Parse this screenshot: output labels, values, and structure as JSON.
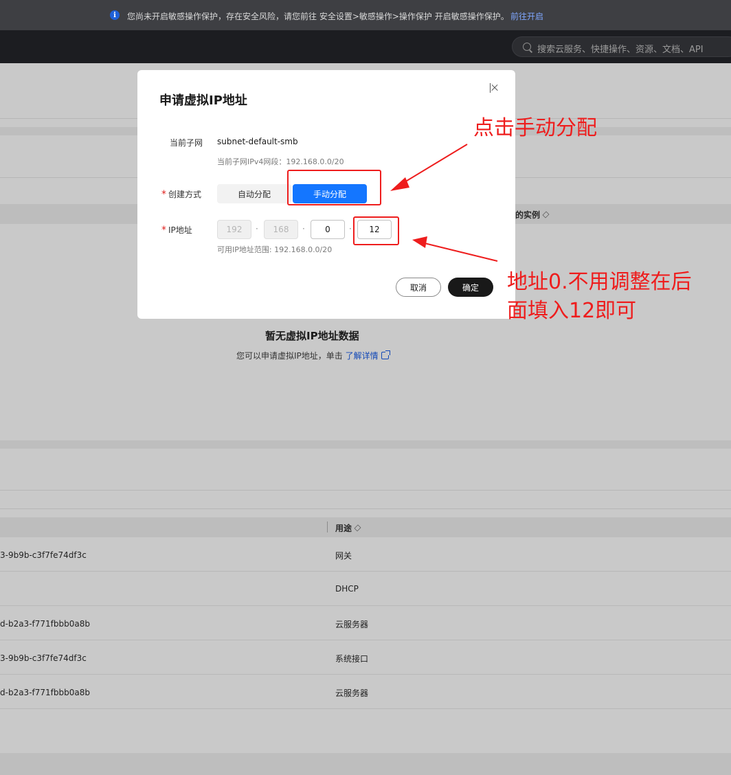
{
  "banner": {
    "info_icon": "i",
    "message": "您尚未开启敏感操作保护，存在安全风险，请您前往 安全设置>敏感操作>操作保护 开启敏感操作保护。",
    "link": "前往开启"
  },
  "navbar": {
    "search_placeholder": "搜索云服务、快捷操作、资源、文档、API"
  },
  "background": {
    "upper_table_header_right": "的实例",
    "empty_title": "暂无虚拟IP地址数据",
    "empty_desc": "您可以申请虚拟IP地址，单击",
    "empty_link": "了解详情",
    "lower_table_header_usage": "用途",
    "rows": [
      {
        "id": "3-9b9b-c3f7fe74df3c",
        "usage": "网关"
      },
      {
        "id": "",
        "usage": "DHCP"
      },
      {
        "id": "d-b2a3-f771fbbb0a8b",
        "usage": "云服务器"
      },
      {
        "id": "3-9b9b-c3f7fe74df3c",
        "usage": "系统接口"
      },
      {
        "id": "d-b2a3-f771fbbb0a8b",
        "usage": "云服务器"
      }
    ]
  },
  "modal": {
    "title": "申请虚拟IP地址",
    "subnet_label": "当前子网",
    "subnet_value": "subnet-default-smb",
    "subnet_hint": "当前子网IPv4网段：192.168.0.0/20",
    "method_label": "创建方式",
    "method_options": [
      "自动分配",
      "手动分配"
    ],
    "method_selected": "手动分配",
    "ip_label": "IP地址",
    "ip_octets": [
      "192",
      "168",
      "0",
      "12"
    ],
    "ip_separator": "·",
    "ip_hint": "可用IP地址范围: 192.168.0.0/20",
    "required_mark": "*",
    "cancel": "取消",
    "confirm": "确定"
  },
  "annotations": {
    "note1": "点击手动分配",
    "note2_line1": "地址0.不用调整在后",
    "note2_line2": "面填入12即可",
    "color": "#ee1d1d"
  },
  "colors": {
    "primary_blue": "#1476ff",
    "confirm_black": "#191919",
    "overlay_gray": "#c9c9c9"
  }
}
